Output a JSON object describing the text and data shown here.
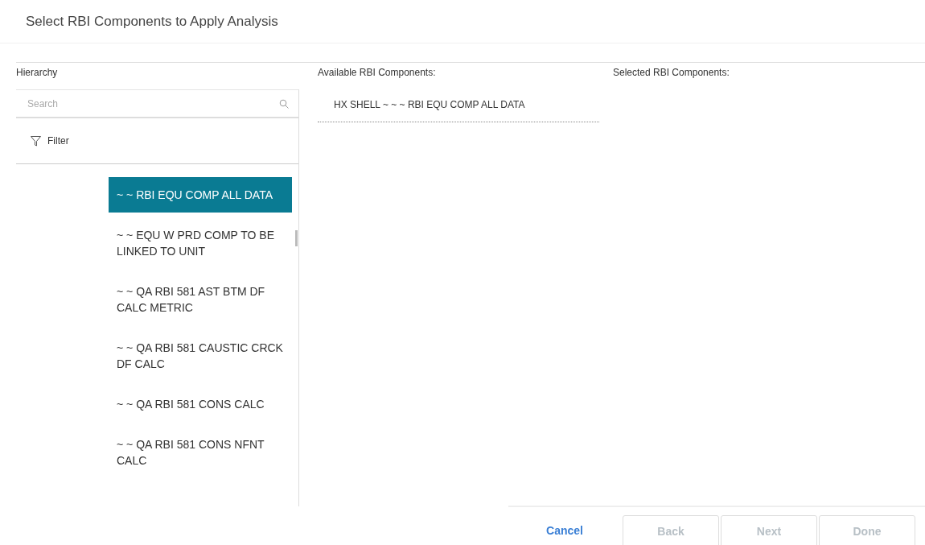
{
  "dialog": {
    "title": "Select RBI Components to Apply Analysis"
  },
  "hierarchy": {
    "label": "Hierarchy",
    "search": {
      "placeholder": "Search"
    },
    "filter": "Filter",
    "items": [
      {
        "label": "~ ~ RBI EQU COMP ALL DATA",
        "selected": true
      },
      {
        "label": "~ ~ EQU W PRD COMP TO BE LINKED TO UNIT",
        "selected": false
      },
      {
        "label": "~ ~ QA RBI 581 AST BTM DF CALC METRIC",
        "selected": false
      },
      {
        "label": "~ ~ QA RBI 581 CAUSTIC CRCK DF CALC",
        "selected": false
      },
      {
        "label": "~ ~ QA RBI 581 CONS CALC",
        "selected": false
      },
      {
        "label": "~ ~ QA RBI 581 CONS NFNT CALC",
        "selected": false
      }
    ]
  },
  "available": {
    "label": "Available RBI Components:",
    "items": [
      "HX SHELL ~ ~ ~ RBI EQU COMP ALL DATA"
    ]
  },
  "selected_components": {
    "label": "Selected RBI Components:"
  },
  "footer": {
    "cancel": "Cancel",
    "buttons": [
      {
        "label": "Back",
        "disabled": true
      },
      {
        "label": "Next",
        "disabled": true
      },
      {
        "label": "Done",
        "disabled": true
      }
    ]
  }
}
